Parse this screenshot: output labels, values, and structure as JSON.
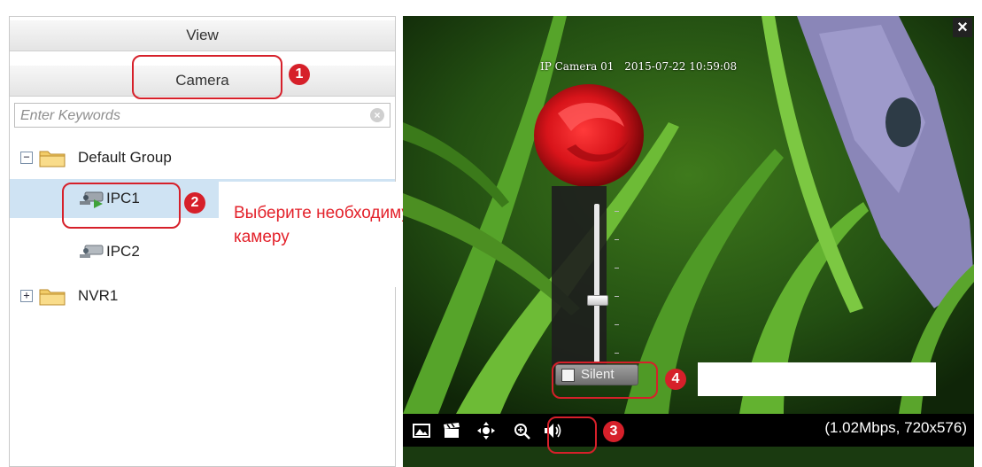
{
  "nav": {
    "view_label": "View",
    "camera_label": "Camera"
  },
  "search": {
    "placeholder": "Enter Keywords",
    "clear_icon": "clear-circle-icon"
  },
  "tree": {
    "groups": [
      {
        "label": "Default Group",
        "expander": "−",
        "expanded": true
      },
      {
        "label": "NVR1",
        "expander": "+",
        "expanded": false
      }
    ],
    "cameras": [
      {
        "label": "IPC1",
        "selected": true
      },
      {
        "label": "IPC2",
        "selected": false
      }
    ]
  },
  "annotation": {
    "callout_text": "Выберите необходимую камеру",
    "markers": [
      "1",
      "2",
      "3",
      "4"
    ],
    "highlight_color": "#d6202a",
    "text_color": "#e3222b"
  },
  "video": {
    "osd_camera": "IP Camera 01",
    "osd_datetime": "2015-07-22 10:59:08",
    "close_icon": "×",
    "silent_label": "Silent",
    "silent_checked": false,
    "volume_level": 0.4,
    "bitrate": "(1.02Mbps, 720x576)"
  },
  "toolbar": {
    "icons": [
      "snapshot-icon",
      "record-clapper-icon",
      "ptz-icon",
      "zoom-icon",
      "volume-icon"
    ]
  }
}
